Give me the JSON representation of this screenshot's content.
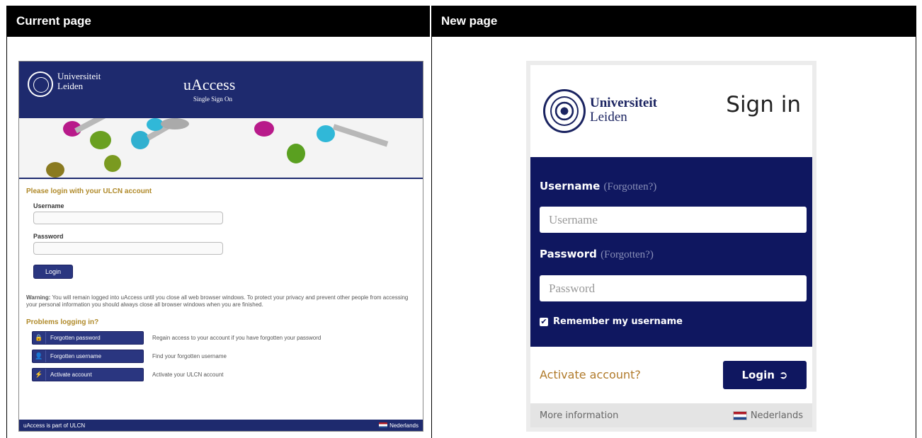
{
  "columns": {
    "left_label": "Current page",
    "right_label": "New page"
  },
  "old_page": {
    "university_line1": "Universiteit",
    "university_line2": "Leiden",
    "app_title": "uAccess",
    "app_subtitle": "Single Sign On",
    "login_heading": "Please login with your ULCN account",
    "username_label": "Username",
    "password_label": "Password",
    "login_button": "Login",
    "warning_bold": "Warning:",
    "warning_text": " You will remain logged into uAccess until you close all web browser windows. To protect your privacy and prevent other people from accessing your personal information you should always close all browser windows when you are finished.",
    "problems_heading": "Problems logging in?",
    "problems": [
      {
        "icon": "lock-icon",
        "glyph": "🔒",
        "label": "Forgotten password",
        "desc": "Regain access to your account if you have forgotten your password"
      },
      {
        "icon": "user-icon",
        "glyph": "👤",
        "label": "Forgotten username",
        "desc": "Find your forgotten username"
      },
      {
        "icon": "bolt-icon",
        "glyph": "⚡",
        "label": "Activate account",
        "desc": "Activate your ULCN account"
      }
    ],
    "footer_left": "uAccess is part of ULCN",
    "footer_right": "Nederlands",
    "colors": {
      "brand_blue": "#1e2a6e",
      "heading_gold": "#b08a2a"
    }
  },
  "new_page": {
    "university_line1": "Universiteit",
    "university_line2": "Leiden",
    "title": "Sign in",
    "username_label": "Username",
    "username_forgot": "(Forgotten?)",
    "username_placeholder": "Username",
    "password_label": "Password",
    "password_forgot": "(Forgotten?)",
    "password_placeholder": "Password",
    "remember_label": "Remember my username",
    "remember_checked": true,
    "activate_link": "Activate account?",
    "login_button": "Login",
    "login_icon": "sign-in-icon",
    "footer_left": "More information",
    "footer_right": "Nederlands",
    "colors": {
      "navy": "#0f1760",
      "link_gold": "#b07a2a"
    }
  }
}
